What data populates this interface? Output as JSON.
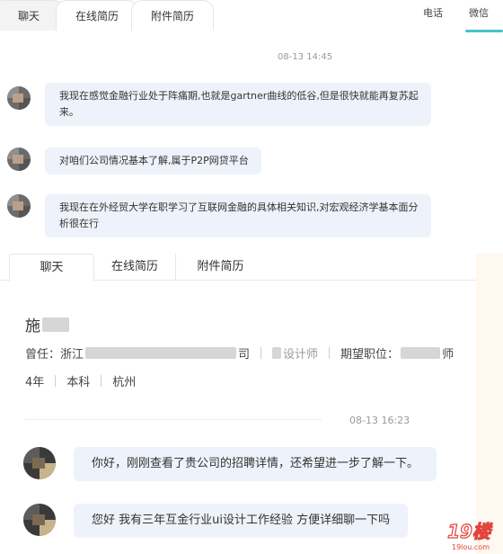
{
  "top": {
    "tabs": [
      "聊天",
      "在线简历",
      "附件简历"
    ],
    "right_links": [
      "电话",
      "微信"
    ],
    "timestamp": "08-13 14:45",
    "messages": [
      "我现在感觉金融行业处于阵痛期,也就是gartner曲线的低谷,但是很快就能再复苏起来。",
      "对咱们公司情况基本了解,属于P2P网贷平台",
      "我现在在外经贸大学在职学习了互联网金融的具体相关知识,对宏观经济学基本面分析很在行"
    ]
  },
  "bottom": {
    "tabs": [
      "聊天",
      "在线简历",
      "附件简历"
    ],
    "candidate_surname": "施",
    "former_label": "曾任：浙江",
    "former_suffix": "司",
    "former_role_fragment": "设计师",
    "expected_label": "期望职位：",
    "expected_suffix": "师",
    "details": [
      "4年",
      "本科",
      "杭州"
    ],
    "timestamp": "08-13 16:23",
    "messages": [
      "你好，刚刚查看了贵公司的招聘详情，还希望进一步了解一下。",
      "您好 我有三年互金行业ui设计工作经验 方便详细聊一下吗"
    ]
  },
  "watermark": {
    "text": "19楼",
    "domain": "19lou.com",
    "color": "#e0453a"
  }
}
